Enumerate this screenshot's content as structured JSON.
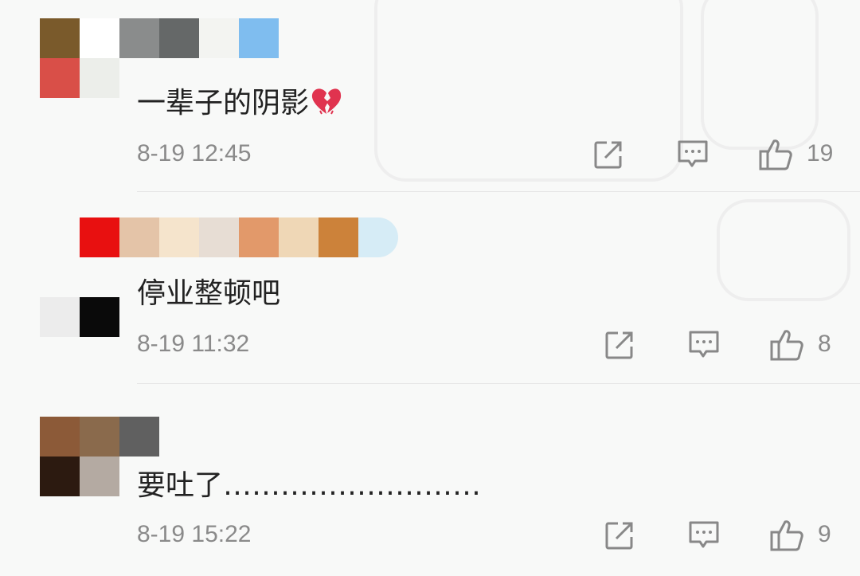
{
  "comments": [
    {
      "text": "一辈子的阴影",
      "emoji_icon": "broken-heart-icon",
      "time": "8-19 12:45",
      "likes": "19",
      "avatar_colors": [
        "#7a5a2b",
        "#ffffff",
        "#d94f48",
        "#eceeea"
      ],
      "name_colors": [
        "#8a8c8c",
        "#656868",
        "#f3f4f1",
        "#7fbdef"
      ]
    },
    {
      "text": "停业整顿吧",
      "time": "8-19 11:32",
      "likes": "8",
      "avatar_colors": [
        "#f8f9f8",
        "#f8f9f8",
        "#ececec",
        "#0a0a0a"
      ],
      "name_colors": [
        "#e81010",
        "#e4c4a8",
        "#f5e4cc",
        "#e7ddd4",
        "#e2996a",
        "#efd7b6",
        "#cc823a",
        "#d6ecf6"
      ]
    },
    {
      "text": "要吐了………………………",
      "time": "8-19 15:22",
      "likes": "9",
      "avatar_colors": [
        "#8c5a38",
        "#8a6a4c",
        "#2c1a10",
        "#b4aaa2"
      ],
      "name_colors": [
        "#606060"
      ]
    }
  ],
  "icons": {
    "share": "share-icon",
    "reply": "comment-icon",
    "like": "thumbs-up-icon"
  }
}
